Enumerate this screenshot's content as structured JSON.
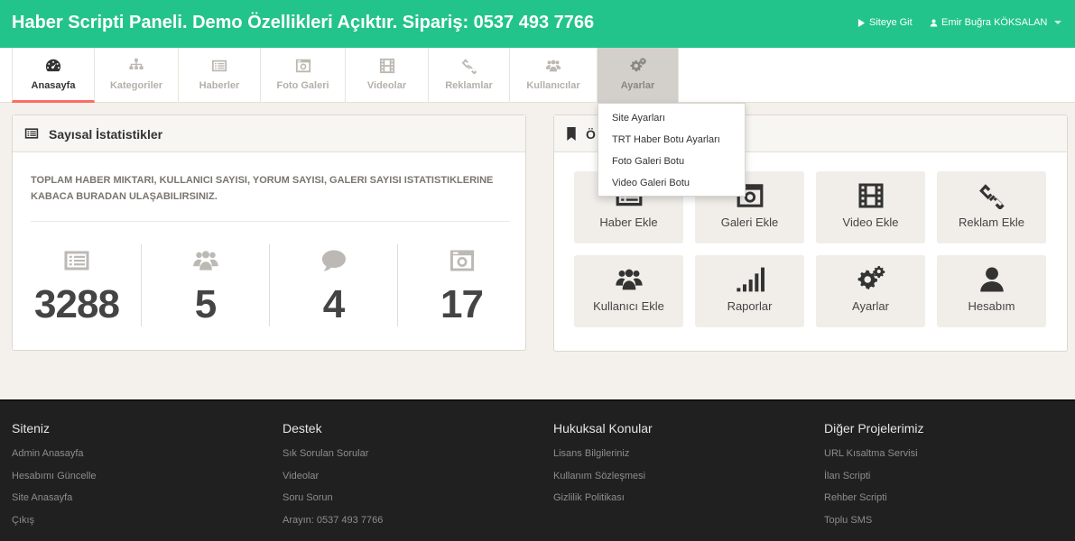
{
  "header": {
    "title": "Haber Scripti Paneli. Demo Özellikleri Açıktır. Sipariş: 0537 493 7766",
    "site_link": "Siteye Git",
    "user_name": "Emir Buğra KÖKSALAN"
  },
  "nav": {
    "tabs": [
      {
        "label": "Anasayfa",
        "icon": "dashboard-icon"
      },
      {
        "label": "Kategoriler",
        "icon": "sitemap-icon"
      },
      {
        "label": "Haberler",
        "icon": "list-icon"
      },
      {
        "label": "Foto Galeri",
        "icon": "camera-icon"
      },
      {
        "label": "Videolar",
        "icon": "film-icon"
      },
      {
        "label": "Reklamlar",
        "icon": "link-icon"
      },
      {
        "label": "Kullanıcılar",
        "icon": "users-icon"
      },
      {
        "label": "Ayarlar",
        "icon": "gears-icon"
      }
    ],
    "active_tab": "Anasayfa",
    "open_tab": "Ayarlar"
  },
  "dropdown": {
    "items": [
      "Site Ayarları",
      "TRT Haber Botu Ayarları",
      "Foto Galeri Botu",
      "Video Galeri Botu"
    ]
  },
  "stats_panel": {
    "title": "Sayısal İstatistikler",
    "description": "Toplam haber miktarı, kullanıcı sayısı, yorum sayısı, galeri sayısı istatistiklerine kabaca buradan ulaşabilirsiniz.",
    "stats": [
      {
        "icon": "list-icon",
        "value": "3288"
      },
      {
        "icon": "users-icon",
        "value": "5"
      },
      {
        "icon": "comment-icon",
        "value": "4"
      },
      {
        "icon": "camera-icon",
        "value": "17"
      }
    ]
  },
  "quick_panel": {
    "title_visible": "Ö",
    "buttons": [
      {
        "label": "Haber Ekle",
        "icon": "list-icon"
      },
      {
        "label": "Galeri Ekle",
        "icon": "camera-icon"
      },
      {
        "label": "Video Ekle",
        "icon": "film-icon"
      },
      {
        "label": "Reklam Ekle",
        "icon": "link-icon"
      },
      {
        "label": "Kullanıcı Ekle",
        "icon": "users-icon"
      },
      {
        "label": "Raporlar",
        "icon": "signal-icon"
      },
      {
        "label": "Ayarlar",
        "icon": "gears-icon"
      },
      {
        "label": "Hesabım",
        "icon": "user-icon"
      }
    ]
  },
  "footer": {
    "columns": [
      {
        "title": "Siteniz",
        "links": [
          "Admin Anasayfa",
          "Hesabımı Güncelle",
          "Site Anasayfa",
          "Çıkış"
        ]
      },
      {
        "title": "Destek",
        "links": [
          "Sık Sorulan Sorular",
          "Videolar",
          "Soru Sorun",
          "Arayın: 0537 493 7766"
        ]
      },
      {
        "title": "Hukuksal Konular",
        "links": [
          "Lisans Bilgileriniz",
          "Kullanım Sözleşmesi",
          "Gizlilik Politikası"
        ]
      },
      {
        "title": "Diğer Projelerimiz",
        "links": [
          "URL Kısaltma Servisi",
          "İlan Scripti",
          "Rehber Scripti",
          "Toplu SMS"
        ]
      }
    ]
  },
  "colors": {
    "header_bg": "#22c48c",
    "active_tab_border": "#ff6c60",
    "footer_bg": "#202020"
  }
}
